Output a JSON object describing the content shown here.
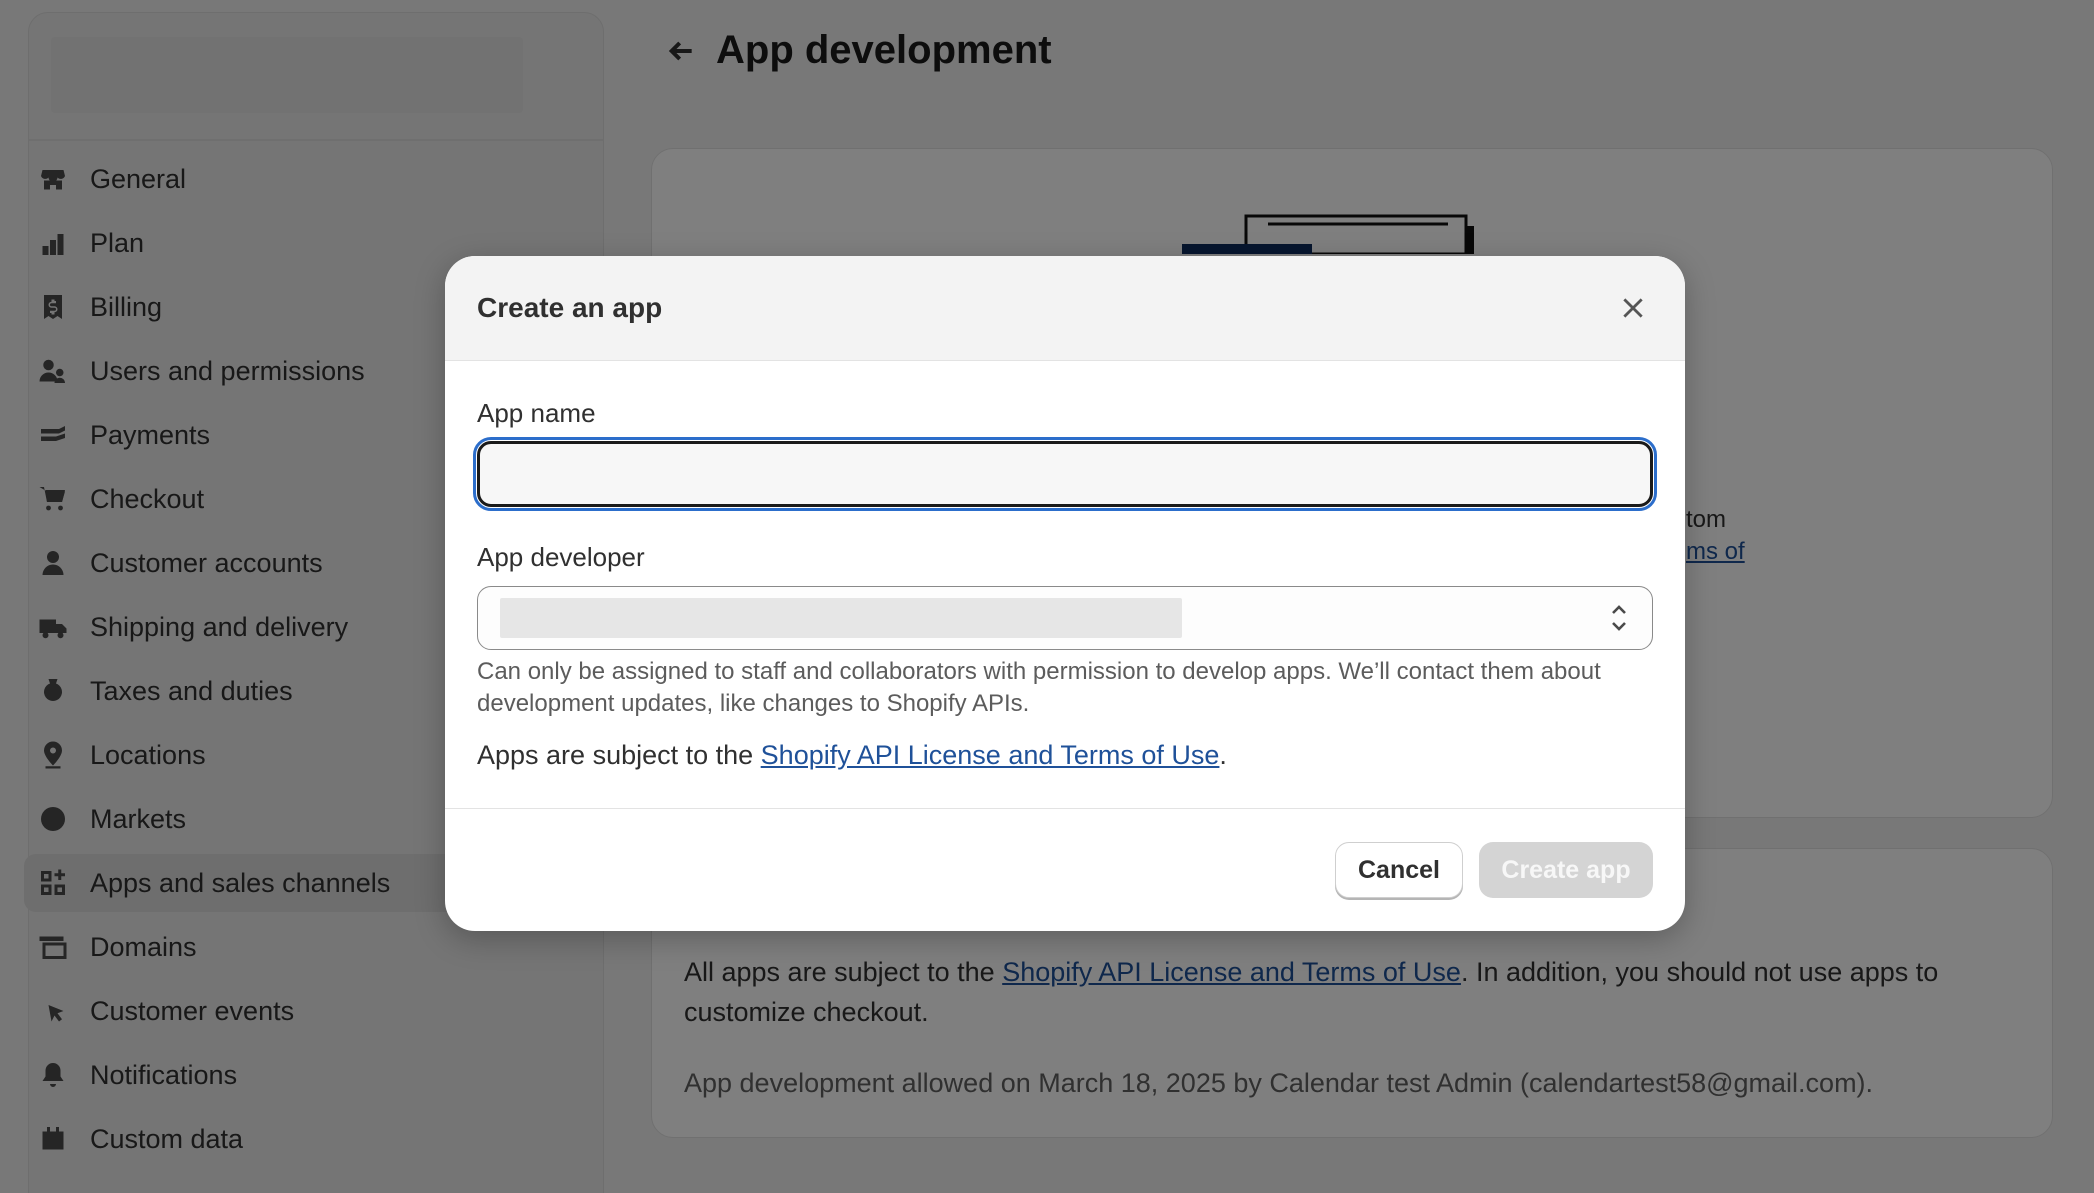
{
  "sidebar": {
    "items": [
      {
        "label": "General",
        "icon": "store-icon"
      },
      {
        "label": "Plan",
        "icon": "plan-icon"
      },
      {
        "label": "Billing",
        "icon": "billing-icon"
      },
      {
        "label": "Users and permissions",
        "icon": "users-icon"
      },
      {
        "label": "Payments",
        "icon": "payments-icon"
      },
      {
        "label": "Checkout",
        "icon": "cart-icon"
      },
      {
        "label": "Customer accounts",
        "icon": "person-icon"
      },
      {
        "label": "Shipping and delivery",
        "icon": "truck-icon"
      },
      {
        "label": "Taxes and duties",
        "icon": "tax-icon"
      },
      {
        "label": "Locations",
        "icon": "location-icon"
      },
      {
        "label": "Markets",
        "icon": "globe-icon"
      },
      {
        "label": "Apps and sales channels",
        "icon": "apps-icon",
        "active": true
      },
      {
        "label": "Domains",
        "icon": "domains-icon"
      },
      {
        "label": "Customer events",
        "icon": "cursor-icon"
      },
      {
        "label": "Notifications",
        "icon": "bell-icon"
      },
      {
        "label": "Custom data",
        "icon": "data-icon"
      }
    ]
  },
  "header": {
    "title": "App development"
  },
  "card1": {
    "text_a": "tom",
    "text_b": "ms of"
  },
  "card2": {
    "p1_prefix": "All apps are subject to the ",
    "p1_link": "Shopify API License and Terms of Use",
    "p1_suffix": ". In addition, you should not use apps to customize checkout.",
    "p2": "App development allowed on March 18, 2025 by Calendar test Admin (calendartest58@gmail.com)."
  },
  "modal": {
    "title": "Create an app",
    "app_name_label": "App name",
    "app_name_value": "",
    "app_developer_label": "App developer",
    "help_text": "Can only be assigned to staff and collaborators with permission to develop apps. We’ll contact them about development updates, like changes to Shopify APIs.",
    "terms_prefix": "Apps are subject to the ",
    "terms_link": "Shopify API License and Terms of Use",
    "terms_suffix": ".",
    "cancel_label": "Cancel",
    "create_label": "Create app"
  },
  "colors": {
    "focus_ring": "#2c6ecb",
    "link": "#1f5199",
    "disabled_button": "#d4d4d4"
  }
}
